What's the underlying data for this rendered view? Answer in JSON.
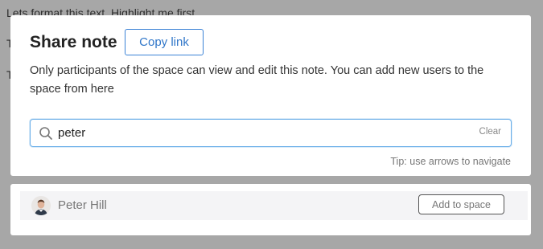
{
  "background_note": {
    "line1": "Lets format this text. Highlight me first",
    "line2": "T",
    "line3": "T"
  },
  "share_modal": {
    "title": "Share note",
    "copy_link_label": "Copy link",
    "description": "Only participants of the space can view and edit this note. You can add new users to the space from here",
    "search": {
      "value": "peter",
      "icon": "search-icon",
      "clear_label": "Clear"
    },
    "tip": "Tip: use arrows to navigate"
  },
  "results": [
    {
      "name": "Peter Hill",
      "avatar": "avatar-photo",
      "action_label": "Add to space"
    }
  ],
  "colors": {
    "accent": "#2f76c9",
    "focus_border": "#6aaee8",
    "row_background": "#f4f4f6"
  }
}
